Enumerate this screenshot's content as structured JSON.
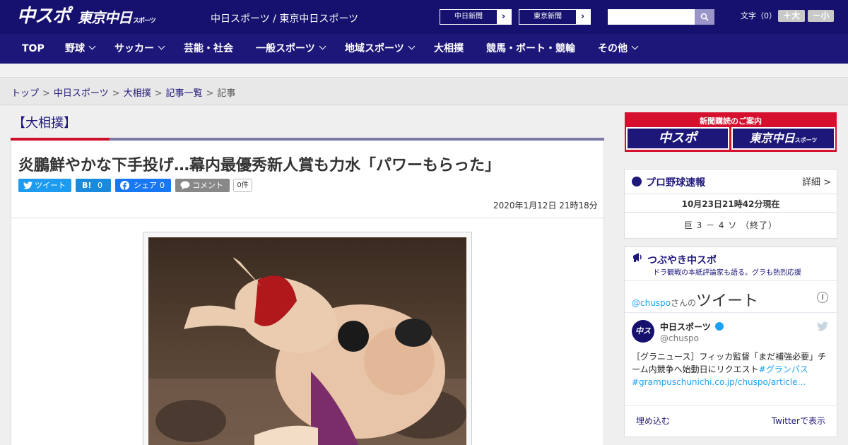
{
  "header": {
    "logo_primary": "中スポ",
    "logo_secondary": "東京中日",
    "logo_secondary_small": "スポーツ",
    "site_name": "中日スポーツ / 東京中日スポーツ",
    "paper_links": [
      {
        "label": "中日新聞",
        "arrow": "›"
      },
      {
        "label": "東京新聞",
        "arrow": "›"
      }
    ],
    "search": {
      "placeholder": "",
      "value": ""
    },
    "font_size_label": "文字（0）",
    "font_larger": "＋大",
    "font_smaller": "－小"
  },
  "nav": {
    "items": [
      {
        "label": "TOP",
        "dropdown": false
      },
      {
        "label": "野球",
        "dropdown": true
      },
      {
        "label": "サッカー",
        "dropdown": true
      },
      {
        "label": "芸能・社会",
        "dropdown": false
      },
      {
        "label": "一般スポーツ",
        "dropdown": true
      },
      {
        "label": "地域スポーツ",
        "dropdown": true
      },
      {
        "label": "大相撲",
        "dropdown": false
      },
      {
        "label": "競馬・ボート・競輪",
        "dropdown": false
      },
      {
        "label": "その他",
        "dropdown": true
      }
    ]
  },
  "breadcrumb": {
    "items": [
      "トップ",
      "中日スポーツ",
      "大相撲",
      "記事一覧"
    ],
    "current": "記事",
    "separator": ">"
  },
  "article": {
    "category": "【大相撲】",
    "headline": "炎鵬鮮やかな下手投げ…幕内最優秀新人賞も力水「パワーもらった」",
    "share": {
      "tweet_label": "ツイート",
      "hatena_label": "B!",
      "hatena_count": "0",
      "facebook_label": "シェア",
      "facebook_count": "0",
      "comment_label": "コメント",
      "comment_count": "0件"
    },
    "date": "2020年1月12日 21時18分",
    "photo_alt": "sumo-throw-photo"
  },
  "sidebar": {
    "subscription": {
      "title": "新聞購読のご案内",
      "logo_primary": "中スポ",
      "logo_secondary": "東京中日",
      "logo_secondary_small": "スポーツ"
    },
    "baseball": {
      "title": "プロ野球速報",
      "detail": "詳細 >",
      "updated": "10月23日21時42分現在",
      "score": "巨 3 － 4 ソ （終了）"
    },
    "tweets": {
      "title": "つぶやき中スポ",
      "subtitle": "ドラ観戦の本紙評論家も語る。グラも熱烈応援",
      "handle": "@chuspo",
      "handle_suffix": "さんの",
      "tweets_word": "ツイート",
      "author_name": "中日スポーツ",
      "author_screen": "@chuspo",
      "avatar_text": "中スポ",
      "text_plain": "［グラニュース］フィッカ監督「まだ補強必要」チーム内競争へ始動日にリクエスト",
      "text_hashtag": "#グランパス",
      "text_link": "#grampuschunichi.co.jp/chuspo/article…",
      "embed_label": "埋め込む",
      "show_label": "Twitterで表示"
    }
  },
  "colors": {
    "header_bg": "#16116e",
    "nav_bg": "#1e177a",
    "accent_red": "#d0102a",
    "twitter_blue": "#1da1f2"
  }
}
